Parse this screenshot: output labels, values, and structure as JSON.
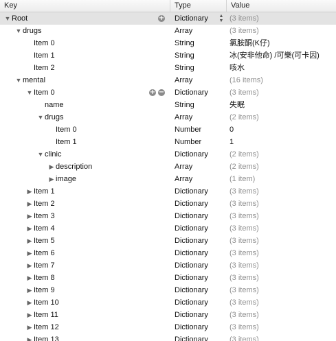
{
  "header": {
    "key": "Key",
    "type": "Type",
    "value": "Value"
  },
  "rows": [
    {
      "key": "Root",
      "type": "Dictionary",
      "value": "(3 items)",
      "value_dim": true,
      "depth": 0,
      "disclosure": "down",
      "selected": true,
      "controls": [
        "add"
      ],
      "updown": true
    },
    {
      "key": "drugs",
      "type": "Array",
      "value": "(3 items)",
      "value_dim": true,
      "depth": 1,
      "disclosure": "down"
    },
    {
      "key": "Item 0",
      "type": "String",
      "value": "氯胺酮(K仔)",
      "depth": 2
    },
    {
      "key": "Item 1",
      "type": "String",
      "value": "冰(安非他命) /可樂(可卡因)",
      "depth": 2
    },
    {
      "key": "Item 2",
      "type": "String",
      "value": "咳水",
      "depth": 2
    },
    {
      "key": "mental",
      "type": "Array",
      "value": "(16 items)",
      "value_dim": true,
      "depth": 1,
      "disclosure": "down"
    },
    {
      "key": "Item 0",
      "type": "Dictionary",
      "value": "(3 items)",
      "value_dim": true,
      "depth": 2,
      "disclosure": "down",
      "controls": [
        "add",
        "remove"
      ]
    },
    {
      "key": "name",
      "type": "String",
      "value": "失眠",
      "depth": 3
    },
    {
      "key": "drugs",
      "type": "Array",
      "value": "(2 items)",
      "value_dim": true,
      "depth": 3,
      "disclosure": "down"
    },
    {
      "key": "Item 0",
      "type": "Number",
      "value": "0",
      "depth": 4
    },
    {
      "key": "Item 1",
      "type": "Number",
      "value": "1",
      "depth": 4
    },
    {
      "key": "clinic",
      "type": "Dictionary",
      "value": "(2 items)",
      "value_dim": true,
      "depth": 3,
      "disclosure": "down"
    },
    {
      "key": "description",
      "type": "Array",
      "value": "(2 items)",
      "value_dim": true,
      "depth": 4,
      "disclosure": "right"
    },
    {
      "key": "image",
      "type": "Array",
      "value": "(1 item)",
      "value_dim": true,
      "depth": 4,
      "disclosure": "right"
    },
    {
      "key": "Item 1",
      "type": "Dictionary",
      "value": "(3 items)",
      "value_dim": true,
      "depth": 2,
      "disclosure": "right"
    },
    {
      "key": "Item 2",
      "type": "Dictionary",
      "value": "(3 items)",
      "value_dim": true,
      "depth": 2,
      "disclosure": "right"
    },
    {
      "key": "Item 3",
      "type": "Dictionary",
      "value": "(3 items)",
      "value_dim": true,
      "depth": 2,
      "disclosure": "right"
    },
    {
      "key": "Item 4",
      "type": "Dictionary",
      "value": "(3 items)",
      "value_dim": true,
      "depth": 2,
      "disclosure": "right"
    },
    {
      "key": "Item 5",
      "type": "Dictionary",
      "value": "(3 items)",
      "value_dim": true,
      "depth": 2,
      "disclosure": "right"
    },
    {
      "key": "Item 6",
      "type": "Dictionary",
      "value": "(3 items)",
      "value_dim": true,
      "depth": 2,
      "disclosure": "right"
    },
    {
      "key": "Item 7",
      "type": "Dictionary",
      "value": "(3 items)",
      "value_dim": true,
      "depth": 2,
      "disclosure": "right"
    },
    {
      "key": "Item 8",
      "type": "Dictionary",
      "value": "(3 items)",
      "value_dim": true,
      "depth": 2,
      "disclosure": "right"
    },
    {
      "key": "Item 9",
      "type": "Dictionary",
      "value": "(3 items)",
      "value_dim": true,
      "depth": 2,
      "disclosure": "right"
    },
    {
      "key": "Item 10",
      "type": "Dictionary",
      "value": "(3 items)",
      "value_dim": true,
      "depth": 2,
      "disclosure": "right"
    },
    {
      "key": "Item 11",
      "type": "Dictionary",
      "value": "(3 items)",
      "value_dim": true,
      "depth": 2,
      "disclosure": "right"
    },
    {
      "key": "Item 12",
      "type": "Dictionary",
      "value": "(3 items)",
      "value_dim": true,
      "depth": 2,
      "disclosure": "right"
    },
    {
      "key": "Item 13",
      "type": "Dictionary",
      "value": "(3 items)",
      "value_dim": true,
      "depth": 2,
      "disclosure": "right"
    }
  ]
}
